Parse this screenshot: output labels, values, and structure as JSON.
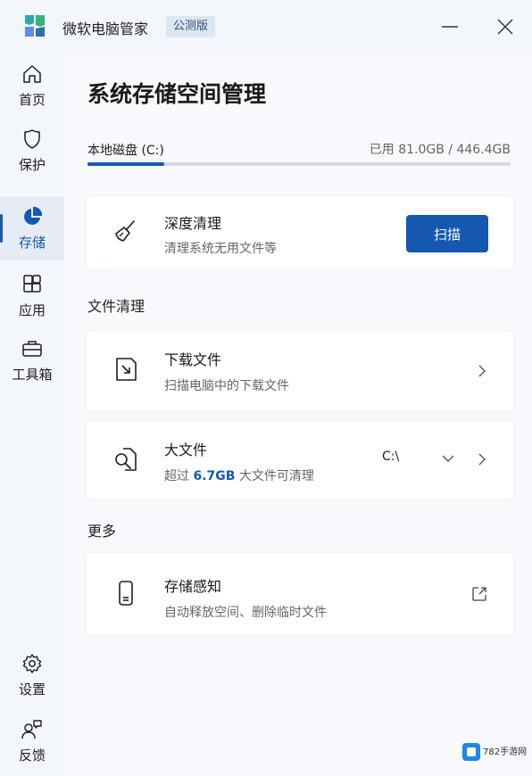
{
  "window": {
    "title": "微软电脑管家",
    "badge": "公测版"
  },
  "sidebar": {
    "items": [
      {
        "label": "首页",
        "icon": "home-icon"
      },
      {
        "label": "保护",
        "icon": "shield-icon"
      },
      {
        "label": "存储",
        "icon": "pie-chart-icon",
        "active": true
      },
      {
        "label": "应用",
        "icon": "apps-icon"
      },
      {
        "label": "工具箱",
        "icon": "toolbox-icon"
      }
    ],
    "bottom_items": [
      {
        "label": "设置",
        "icon": "gear-icon"
      },
      {
        "label": "反馈",
        "icon": "feedback-icon"
      }
    ]
  },
  "page": {
    "title": "系统存储空间管理",
    "disk": {
      "label": "本地磁盘 (C:)",
      "used_text": "已用 81.0GB / 446.4GB",
      "used_fraction": 0.181
    }
  },
  "deep_clean": {
    "title": "深度清理",
    "subtitle": "清理系统无用文件等",
    "button": "扫描"
  },
  "file_clean": {
    "section_title": "文件清理",
    "downloads": {
      "title": "下载文件",
      "subtitle": "扫描电脑中的下载文件"
    },
    "large_files": {
      "title": "大文件",
      "subtitle_prefix": "超过",
      "size": "6.7GB",
      "subtitle_suffix": "大文件可清理",
      "drive": "C:\\"
    }
  },
  "more": {
    "section_title": "更多",
    "storage_sense": {
      "title": "存储感知",
      "subtitle": "自动释放空间、删除临时文件"
    }
  },
  "colors": {
    "accent": "#1558b0",
    "background": "#f3f6fb",
    "card": "#ffffff"
  },
  "watermark": {
    "text": "782手游网"
  }
}
